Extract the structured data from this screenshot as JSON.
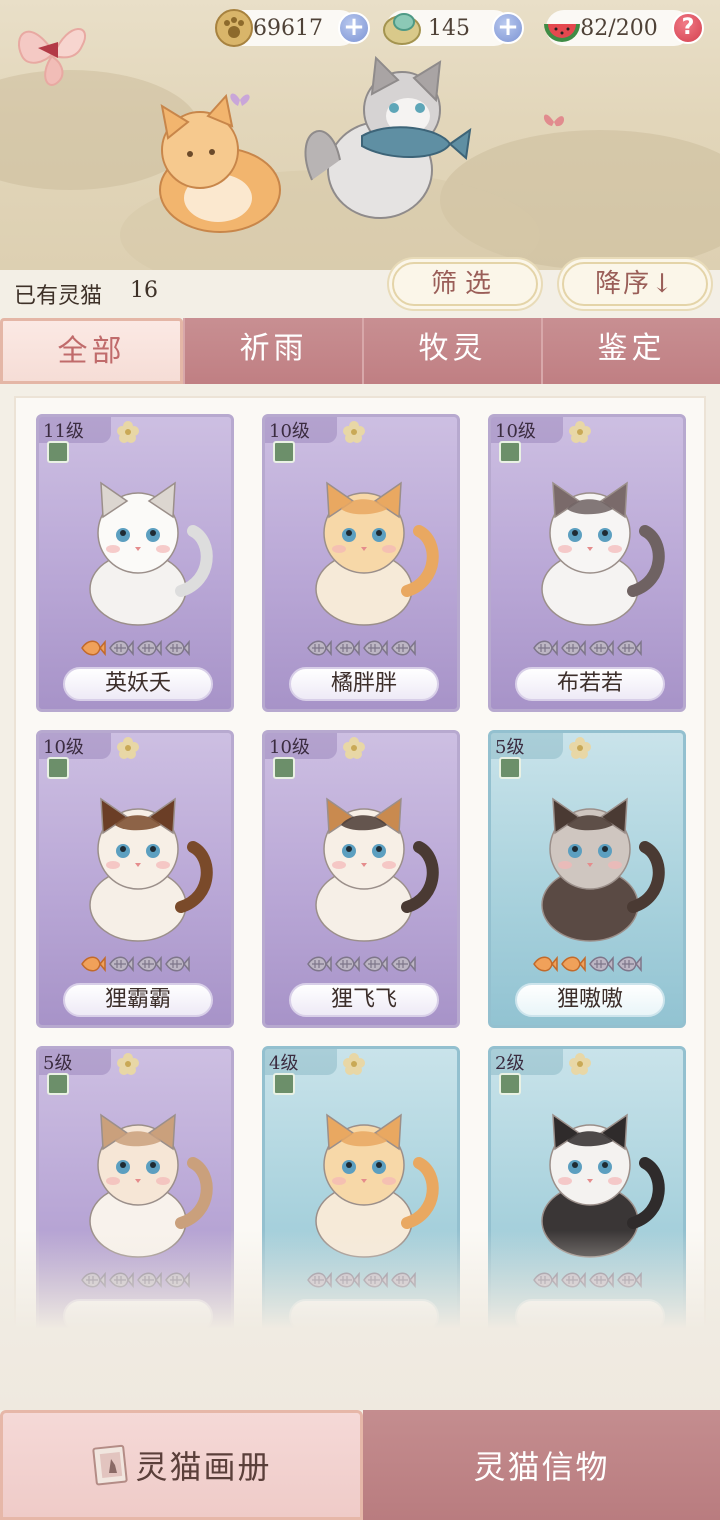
{
  "resources": [
    {
      "name": "paw-coin",
      "value": "69617",
      "action": "add"
    },
    {
      "name": "jade",
      "value": "145",
      "action": "add"
    },
    {
      "name": "stamina",
      "value": "82/200",
      "action": "help"
    }
  ],
  "owned": {
    "label": "已有灵猫",
    "count": "16"
  },
  "filter_label": "筛选",
  "sort_label": "降序↓",
  "tabs": [
    {
      "label": "全部",
      "active": true
    },
    {
      "label": "祈雨",
      "active": false
    },
    {
      "label": "牧灵",
      "active": false
    },
    {
      "label": "鉴定",
      "active": false
    }
  ],
  "cards": [
    {
      "level": "11级",
      "name": "英妖夭",
      "theme": "purple",
      "fish_gold": 1,
      "coat": "white"
    },
    {
      "level": "10级",
      "name": "橘胖胖",
      "theme": "purple",
      "fish_gold": 0,
      "coat": "orange"
    },
    {
      "level": "10级",
      "name": "布若若",
      "theme": "purple",
      "fish_gold": 0,
      "coat": "gray"
    },
    {
      "level": "10级",
      "name": "狸霸霸",
      "theme": "purple",
      "fish_gold": 1,
      "coat": "calico"
    },
    {
      "level": "10级",
      "name": "狸飞飞",
      "theme": "purple",
      "fish_gold": 0,
      "coat": "calico2"
    },
    {
      "level": "5级",
      "name": "狸嗷嗷",
      "theme": "blue",
      "fish_gold": 2,
      "coat": "brown"
    },
    {
      "level": "5级",
      "name": "",
      "theme": "purple",
      "fish_gold": 0,
      "coat": "cream"
    },
    {
      "level": "4级",
      "name": "",
      "theme": "blue",
      "fish_gold": 0,
      "coat": "orange"
    },
    {
      "level": "2级",
      "name": "",
      "theme": "blue",
      "fish_gold": 0,
      "coat": "tuxedo"
    }
  ],
  "bottom_tabs": [
    {
      "label": "灵猫画册",
      "active": true
    },
    {
      "label": "灵猫信物",
      "active": false
    }
  ]
}
